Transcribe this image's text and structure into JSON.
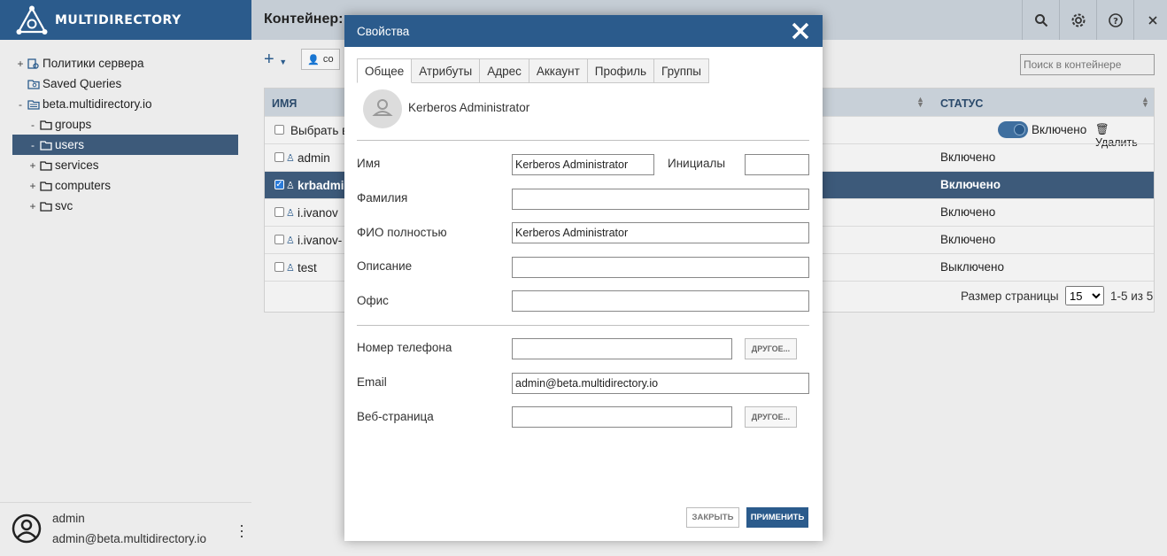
{
  "app": {
    "brand": "MULTIDIRECTORY"
  },
  "sidebar": {
    "tree": [
      {
        "expander": "+",
        "icon": "policy-icon",
        "label": "Политики сервера",
        "indent": 18
      },
      {
        "expander": "",
        "icon": "saved-query-icon",
        "label": "Saved Queries",
        "indent": 18
      },
      {
        "expander": "-",
        "icon": "domain-icon",
        "label": "beta.multidirectory.io",
        "indent": 18
      },
      {
        "expander": "-",
        "icon": "folder-icon",
        "label": "groups",
        "indent": 32
      },
      {
        "expander": "-",
        "icon": "folder-icon",
        "label": "users",
        "indent": 32,
        "selected": true
      },
      {
        "expander": "+",
        "icon": "folder-icon",
        "label": "services",
        "indent": 32
      },
      {
        "expander": "+",
        "icon": "folder-icon",
        "label": "computers",
        "indent": 32
      },
      {
        "expander": "+",
        "icon": "folder-icon",
        "label": "svc",
        "indent": 32
      }
    ],
    "user": {
      "name": "admin",
      "email": "admin@beta.multidirectory.io"
    }
  },
  "main": {
    "title": "Контейнер:",
    "toolbar": {
      "create_label": "со"
    },
    "search": {
      "placeholder": "Поиск в контейнере"
    },
    "grid": {
      "col_name": "ИМЯ",
      "col_status": "СТАТУС",
      "select_all": "Выбрать в",
      "toggle_label": "Включено",
      "delete_label": "Удалить",
      "rows": [
        {
          "name": "admin",
          "status": "Включено"
        },
        {
          "name": "krbadmi",
          "status": "Включено",
          "selected": true
        },
        {
          "name": "i.ivanov",
          "status": "Включено"
        },
        {
          "name": "i.ivanov-",
          "status": "Включено"
        },
        {
          "name": "test",
          "status": "Выключено"
        }
      ],
      "page_size_label": "Размер страницы",
      "page_size": "15",
      "count": "1-5 из 5"
    }
  },
  "dialog": {
    "title": "Свойства",
    "tabs": [
      "Общее",
      "Атрибуты",
      "Адрес",
      "Аккаунт",
      "Профиль",
      "Группы"
    ],
    "active_tab": 0,
    "display_name": "Kerberos Administrator",
    "fields": {
      "first_name_label": "Имя",
      "first_name": "Kerberos Administrator",
      "initials_label": "Инициалы",
      "initials": "",
      "last_name_label": "Фамилия",
      "last_name": "",
      "full_name_label": "ФИО полностью",
      "full_name": "Kerberos Administrator",
      "description_label": "Описание",
      "description": "",
      "office_label": "Офис",
      "office": "",
      "phone_label": "Номер телефона",
      "phone": "",
      "email_label": "Email",
      "email": "admin@beta.multidirectory.io",
      "web_label": "Веб-страница",
      "web": ""
    },
    "other_label": "ДРУГОЕ...",
    "close_label": "ЗАКРЫТЬ",
    "apply_label": "ПРИМЕНИТЬ"
  }
}
